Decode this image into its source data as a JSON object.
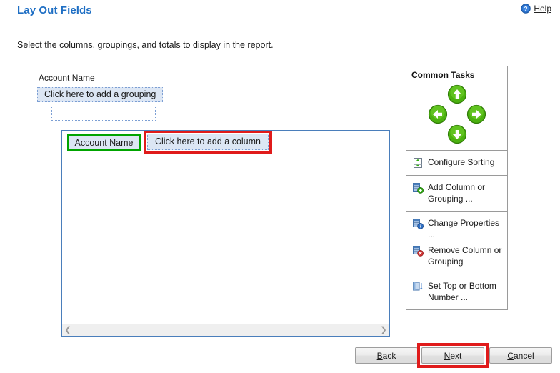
{
  "header": {
    "title": "Lay Out Fields",
    "help_label": "Help",
    "help_icon": "help-circle-icon",
    "subtitle": "Select the columns, groupings, and totals to display in the report."
  },
  "grouping": {
    "field_label": "Account Name",
    "add_grouping_text": "Click here to add a grouping",
    "empty_slot_text": ""
  },
  "report": {
    "column_selected": "Account Name",
    "add_column_text": "Click here to add a column",
    "scroll_left_icon": "chevron-left-icon",
    "scroll_right_icon": "chevron-right-icon"
  },
  "common_tasks": {
    "title": "Common Tasks",
    "nav": {
      "up": "move-up-arrow",
      "left": "move-left-arrow",
      "right": "move-right-arrow",
      "down": "move-down-arrow"
    },
    "groups": [
      {
        "items": [
          {
            "label": "Configure Sorting",
            "icon": "configure-sorting-icon"
          }
        ]
      },
      {
        "items": [
          {
            "label": "Add Column or Grouping ...",
            "icon": "add-column-icon"
          }
        ]
      },
      {
        "items": [
          {
            "label": "Change Properties ...",
            "icon": "change-properties-icon"
          },
          {
            "label": "Remove Column or Grouping",
            "icon": "remove-column-icon"
          }
        ]
      },
      {
        "items": [
          {
            "label": "Set Top or Bottom Number ...",
            "icon": "set-top-bottom-icon"
          }
        ]
      }
    ]
  },
  "footer": {
    "back": {
      "accesskey": "B",
      "rest": "ack"
    },
    "next": {
      "accesskey": "N",
      "rest": "ext"
    },
    "cancel": {
      "accesskey": "C",
      "rest": "ancel"
    }
  },
  "colors": {
    "title_blue": "#1f6fc4",
    "panel_blue": "#4a7ebb",
    "selected_green": "#00a400",
    "highlight_red": "#e01b1b",
    "cell_fill": "#dce6f4"
  }
}
